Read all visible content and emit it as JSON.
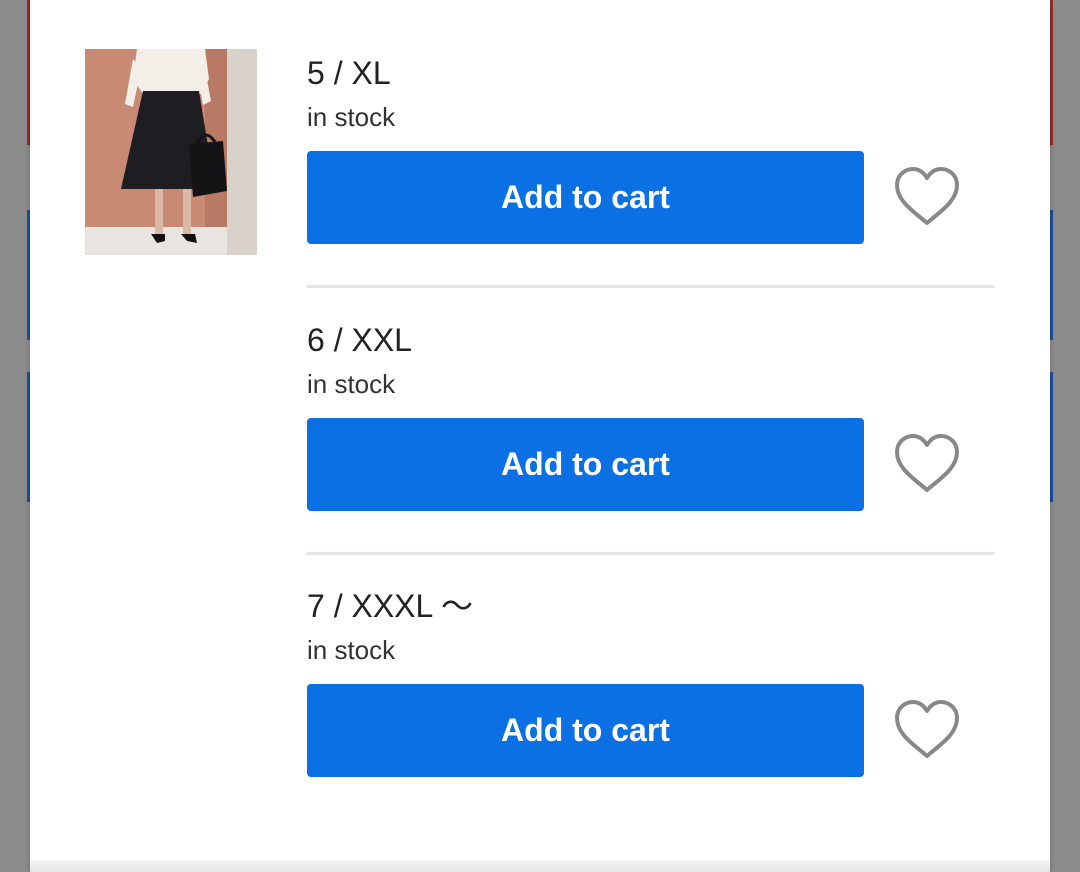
{
  "colors": {
    "accent": "#0a70e4",
    "button_text": "#ffffff",
    "divider": "#e3e3ea",
    "heart_outline": "#888888",
    "page_background": "#ffffff",
    "overlay": "#8a8a8a"
  },
  "product": {
    "image": "product-photo-skirt"
  },
  "variants": [
    {
      "title": "5 / XL",
      "stock": "in stock",
      "button_label": "Add to cart",
      "wishlist_icon": "heart-outline-icon"
    },
    {
      "title": "6 / XXL",
      "stock": "in stock",
      "button_label": "Add to cart",
      "wishlist_icon": "heart-outline-icon"
    },
    {
      "title": "7 / XXXL ～",
      "stock": "in stock",
      "button_label": "Add to cart",
      "wishlist_icon": "heart-outline-icon"
    }
  ]
}
